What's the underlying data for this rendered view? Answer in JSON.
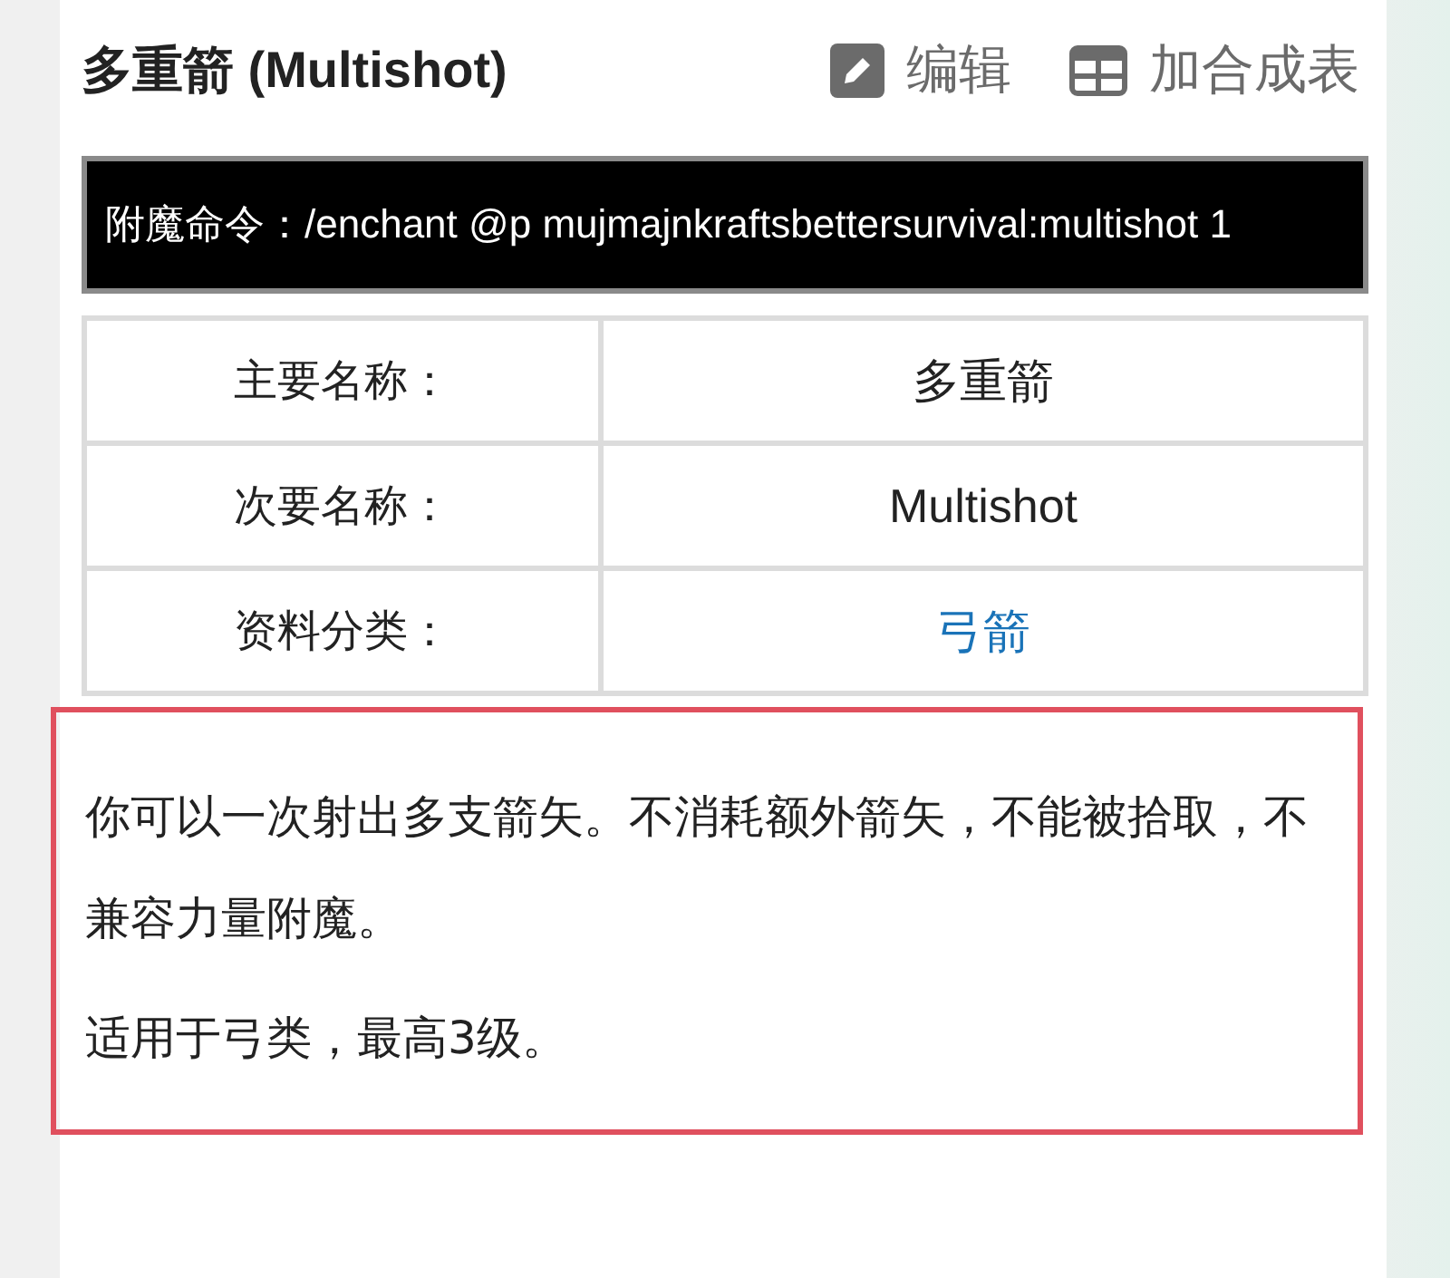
{
  "title": "多重箭 (Multishot)",
  "actions": [
    {
      "kind": "edit",
      "label": "编辑"
    },
    {
      "kind": "table",
      "label": "加合成表"
    }
  ],
  "command": "附魔命令：/enchant @p mujmajnkraftsbettersurvival:multishot 1",
  "info_rows": [
    {
      "label": "主要名称：",
      "value": "多重箭",
      "kind": "text"
    },
    {
      "label": "次要名称：",
      "value": "Multishot",
      "kind": "text"
    },
    {
      "label": "资料分类：",
      "value": "弓箭",
      "kind": "link"
    }
  ],
  "description": [
    "你可以一次射出多支箭矢。不消耗额外箭矢，不能被拾取，不兼容力量附魔。",
    "适用于弓类，最高3级。"
  ]
}
